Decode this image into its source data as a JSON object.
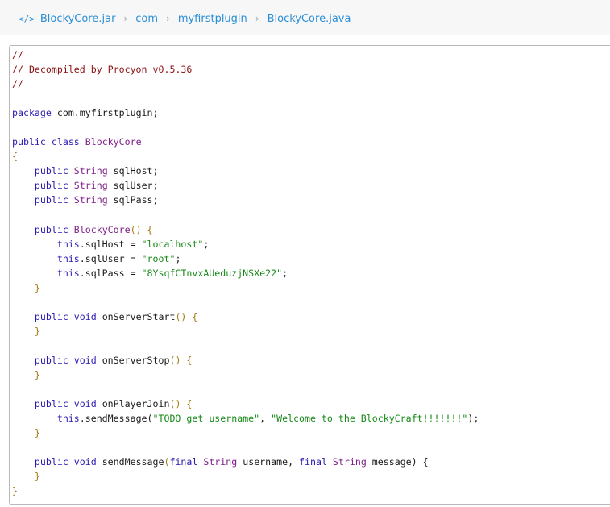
{
  "breadcrumb": {
    "icon": "code-icon",
    "icon_glyph": "</>",
    "separator": "›",
    "items": [
      "BlockyCore.jar",
      "com",
      "myfirstplugin",
      "BlockyCore.java"
    ]
  },
  "code": {
    "lines": [
      [
        {
          "t": "//",
          "c": "comment"
        }
      ],
      [
        {
          "t": "// Decompiled by Procyon v0.5.36",
          "c": "comment"
        }
      ],
      [
        {
          "t": "//",
          "c": "comment"
        }
      ],
      [],
      [
        {
          "t": "package",
          "c": "kw"
        },
        {
          "t": " com.myfirstplugin;",
          "c": "plain"
        }
      ],
      [],
      [
        {
          "t": "public",
          "c": "kw"
        },
        {
          "t": " ",
          "c": "plain"
        },
        {
          "t": "class",
          "c": "kw"
        },
        {
          "t": " ",
          "c": "plain"
        },
        {
          "t": "BlockyCore",
          "c": "type"
        }
      ],
      [
        {
          "t": "{",
          "c": "punc"
        }
      ],
      [
        {
          "t": "    ",
          "c": "plain"
        },
        {
          "t": "public",
          "c": "kw"
        },
        {
          "t": " ",
          "c": "plain"
        },
        {
          "t": "String",
          "c": "type"
        },
        {
          "t": " sqlHost;",
          "c": "plain"
        }
      ],
      [
        {
          "t": "    ",
          "c": "plain"
        },
        {
          "t": "public",
          "c": "kw"
        },
        {
          "t": " ",
          "c": "plain"
        },
        {
          "t": "String",
          "c": "type"
        },
        {
          "t": " sqlUser;",
          "c": "plain"
        }
      ],
      [
        {
          "t": "    ",
          "c": "plain"
        },
        {
          "t": "public",
          "c": "kw"
        },
        {
          "t": " ",
          "c": "plain"
        },
        {
          "t": "String",
          "c": "type"
        },
        {
          "t": " sqlPass;",
          "c": "plain"
        }
      ],
      [],
      [
        {
          "t": "    ",
          "c": "plain"
        },
        {
          "t": "public",
          "c": "kw"
        },
        {
          "t": " ",
          "c": "plain"
        },
        {
          "t": "BlockyCore",
          "c": "type"
        },
        {
          "t": "() {",
          "c": "punc"
        }
      ],
      [
        {
          "t": "        ",
          "c": "plain"
        },
        {
          "t": "this",
          "c": "kw"
        },
        {
          "t": ".sqlHost = ",
          "c": "plain"
        },
        {
          "t": "\"localhost\"",
          "c": "str"
        },
        {
          "t": ";",
          "c": "plain"
        }
      ],
      [
        {
          "t": "        ",
          "c": "plain"
        },
        {
          "t": "this",
          "c": "kw"
        },
        {
          "t": ".sqlUser = ",
          "c": "plain"
        },
        {
          "t": "\"root\"",
          "c": "str"
        },
        {
          "t": ";",
          "c": "plain"
        }
      ],
      [
        {
          "t": "        ",
          "c": "plain"
        },
        {
          "t": "this",
          "c": "kw"
        },
        {
          "t": ".sqlPass = ",
          "c": "plain"
        },
        {
          "t": "\"8YsqfCTnvxAUeduzjNSXe22\"",
          "c": "str"
        },
        {
          "t": ";",
          "c": "plain"
        }
      ],
      [
        {
          "t": "    }",
          "c": "punc"
        }
      ],
      [],
      [
        {
          "t": "    ",
          "c": "plain"
        },
        {
          "t": "public",
          "c": "kw"
        },
        {
          "t": " ",
          "c": "plain"
        },
        {
          "t": "void",
          "c": "kw"
        },
        {
          "t": " onServerStart",
          "c": "plain"
        },
        {
          "t": "() {",
          "c": "punc"
        }
      ],
      [
        {
          "t": "    }",
          "c": "punc"
        }
      ],
      [],
      [
        {
          "t": "    ",
          "c": "plain"
        },
        {
          "t": "public",
          "c": "kw"
        },
        {
          "t": " ",
          "c": "plain"
        },
        {
          "t": "void",
          "c": "kw"
        },
        {
          "t": " onServerStop",
          "c": "plain"
        },
        {
          "t": "() {",
          "c": "punc"
        }
      ],
      [
        {
          "t": "    }",
          "c": "punc"
        }
      ],
      [],
      [
        {
          "t": "    ",
          "c": "plain"
        },
        {
          "t": "public",
          "c": "kw"
        },
        {
          "t": " ",
          "c": "plain"
        },
        {
          "t": "void",
          "c": "kw"
        },
        {
          "t": " onPlayerJoin",
          "c": "plain"
        },
        {
          "t": "() {",
          "c": "punc"
        }
      ],
      [
        {
          "t": "        ",
          "c": "plain"
        },
        {
          "t": "this",
          "c": "kw"
        },
        {
          "t": ".sendMessage(",
          "c": "plain"
        },
        {
          "t": "\"TODO get username\"",
          "c": "str"
        },
        {
          "t": ", ",
          "c": "plain"
        },
        {
          "t": "\"Welcome to the BlockyCraft!!!!!!!\"",
          "c": "str"
        },
        {
          "t": ");",
          "c": "plain"
        }
      ],
      [
        {
          "t": "    }",
          "c": "punc"
        }
      ],
      [],
      [
        {
          "t": "    ",
          "c": "plain"
        },
        {
          "t": "public",
          "c": "kw"
        },
        {
          "t": " ",
          "c": "plain"
        },
        {
          "t": "void",
          "c": "kw"
        },
        {
          "t": " sendMessage",
          "c": "plain"
        },
        {
          "t": "(",
          "c": "punc"
        },
        {
          "t": "final",
          "c": "kw"
        },
        {
          "t": " ",
          "c": "plain"
        },
        {
          "t": "String",
          "c": "type"
        },
        {
          "t": " username, ",
          "c": "plain"
        },
        {
          "t": "final",
          "c": "kw"
        },
        {
          "t": " ",
          "c": "plain"
        },
        {
          "t": "String",
          "c": "type"
        },
        {
          "t": " message) {",
          "c": "plain"
        }
      ],
      [
        {
          "t": "    }",
          "c": "punc"
        }
      ],
      [
        {
          "t": "}",
          "c": "punc"
        }
      ]
    ]
  }
}
